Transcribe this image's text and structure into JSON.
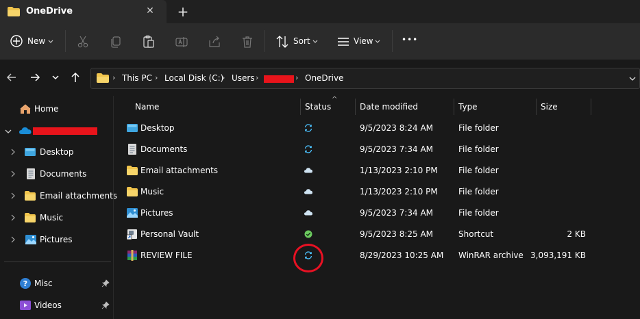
{
  "window": {
    "tab_title": "OneDrive",
    "close_glyph": "✕",
    "new_tab_glyph": "+"
  },
  "toolbar": {
    "new_label": "New",
    "sort_label": "Sort",
    "view_label": "View",
    "more_glyph": "•••",
    "icons": [
      "cut-icon",
      "copy-icon",
      "paste-icon",
      "rename-icon",
      "share-icon",
      "delete-icon"
    ]
  },
  "address": {
    "crumbs": [
      "This PC",
      "Local Disk (C:)",
      "Users",
      "OneDrive"
    ],
    "separator": "›"
  },
  "sidebar": {
    "home_label": "Home",
    "items": [
      {
        "label": "Desktop",
        "icon": "desktop-icon"
      },
      {
        "label": "Documents",
        "icon": "documents-icon"
      },
      {
        "label": "Email attachments",
        "icon": "folder-icon"
      },
      {
        "label": "Music",
        "icon": "folder-icon"
      },
      {
        "label": "Pictures",
        "icon": "pictures-icon"
      }
    ],
    "pinned": [
      {
        "label": "Misc",
        "icon": "info-icon"
      },
      {
        "label": "Videos",
        "icon": "videos-icon"
      }
    ]
  },
  "columns": {
    "name": "Name",
    "status": "Status",
    "date": "Date modified",
    "type": "Type",
    "size": "Size"
  },
  "files": [
    {
      "name": "Desktop",
      "status": "syncing",
      "date": "9/5/2023 8:24 AM",
      "type": "File folder",
      "size": ""
    },
    {
      "name": "Documents",
      "status": "syncing",
      "date": "9/5/2023 7:34 AM",
      "type": "File folder",
      "size": ""
    },
    {
      "name": "Email attachments",
      "status": "cloud",
      "date": "1/13/2023 2:10 PM",
      "type": "File folder",
      "size": ""
    },
    {
      "name": "Music",
      "status": "cloud",
      "date": "1/13/2023 2:10 PM",
      "type": "File folder",
      "size": ""
    },
    {
      "name": "Pictures",
      "status": "cloud",
      "date": "9/5/2023 7:34 AM",
      "type": "File folder",
      "size": ""
    },
    {
      "name": "Personal Vault",
      "status": "available",
      "date": "9/5/2023 8:25 AM",
      "type": "Shortcut",
      "size": "2 KB"
    },
    {
      "name": "REVIEW FILE",
      "status": "syncing",
      "date": "8/29/2023 10:25 AM",
      "type": "WinRAR archive",
      "size": "3,093,191 KB"
    }
  ],
  "colors": {
    "accent": "#4cc2ff",
    "folder": "#f0c44c",
    "redaction": "#e8141b",
    "available": "#6ccb5f"
  }
}
